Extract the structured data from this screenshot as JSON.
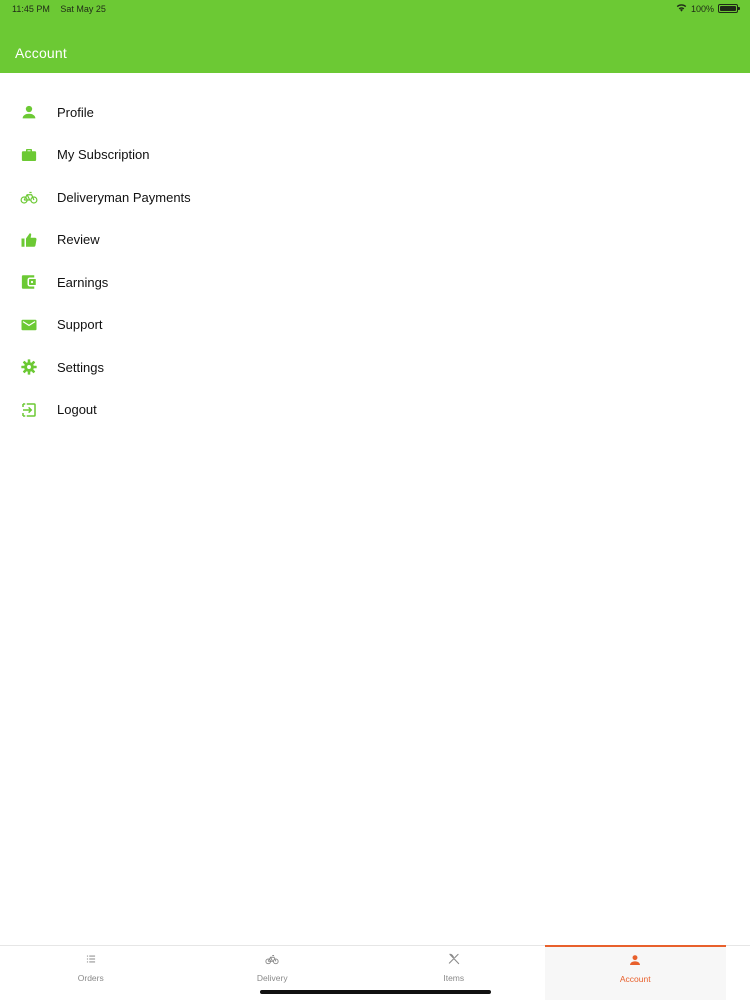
{
  "status_bar": {
    "time": "11:45 PM",
    "date": "Sat May 25",
    "battery_text": "100%",
    "battery_level": 1.0
  },
  "header": {
    "title": "Account"
  },
  "colors": {
    "brand_green": "#6cc934",
    "active_tab": "#e8602c",
    "inactive_tab": "#8a8a8a"
  },
  "menu": {
    "items": [
      {
        "label": "Profile",
        "icon": "person-icon"
      },
      {
        "label": "My Subscription",
        "icon": "briefcase-icon"
      },
      {
        "label": "Deliveryman Payments",
        "icon": "bicycle-icon"
      },
      {
        "label": "Review",
        "icon": "thumbs-up-icon"
      },
      {
        "label": "Earnings",
        "icon": "wallet-icon"
      },
      {
        "label": "Support",
        "icon": "mail-icon"
      },
      {
        "label": "Settings",
        "icon": "gear-icon"
      },
      {
        "label": "Logout",
        "icon": "logout-icon"
      }
    ]
  },
  "tabs": [
    {
      "label": "Orders",
      "icon": "list-icon",
      "active": false
    },
    {
      "label": "Delivery",
      "icon": "bicycle-icon",
      "active": false
    },
    {
      "label": "Items",
      "icon": "utensils-icon",
      "active": false
    },
    {
      "label": "Account",
      "icon": "person-icon",
      "active": true
    }
  ]
}
